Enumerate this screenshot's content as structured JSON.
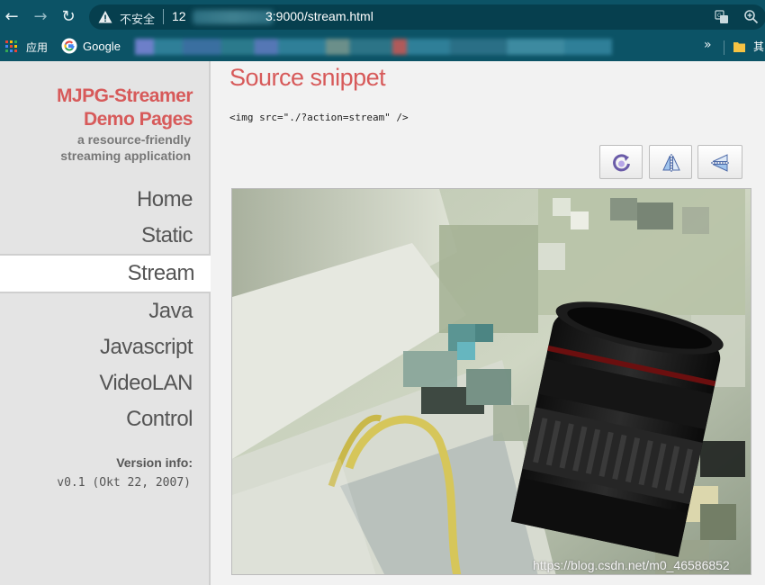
{
  "browser": {
    "insecure_label": "不安全",
    "url_host_visible": "12",
    "url_path": "3:9000/stream.html",
    "bookmarks": {
      "apps_label": "应用",
      "google_label": "Google",
      "other_label": "其"
    }
  },
  "sidebar": {
    "brand_line1": "MJPG-Streamer",
    "brand_line2": "Demo Pages",
    "tagline_line1": "a resource-friendly",
    "tagline_line2": "streaming application",
    "menu": [
      {
        "label": "Home",
        "active": false
      },
      {
        "label": "Static",
        "active": false
      },
      {
        "label": "Stream",
        "active": true
      },
      {
        "label": "Java",
        "active": false
      },
      {
        "label": "Javascript",
        "active": false
      },
      {
        "label": "VideoLAN",
        "active": false
      },
      {
        "label": "Control",
        "active": false
      }
    ],
    "version_label": "Version info:",
    "version_value": "v0.1 (Okt 22, 2007)"
  },
  "main": {
    "title": "Source snippet",
    "code": "<img src=\"./?action=stream\" />",
    "buttons": [
      {
        "name": "rotate-button",
        "icon": "rotate-icon"
      },
      {
        "name": "flip-vertical-button",
        "icon": "flip-vertical-icon"
      },
      {
        "name": "mirror-horizontal-button",
        "icon": "mirror-horizontal-icon"
      }
    ],
    "watermark": "https://blog.csdn.net/m0_46586852"
  },
  "colors": {
    "browser_chrome": "#0c5366",
    "accent_red": "#d75a5a",
    "sidebar_bg": "#e4e4e4"
  }
}
